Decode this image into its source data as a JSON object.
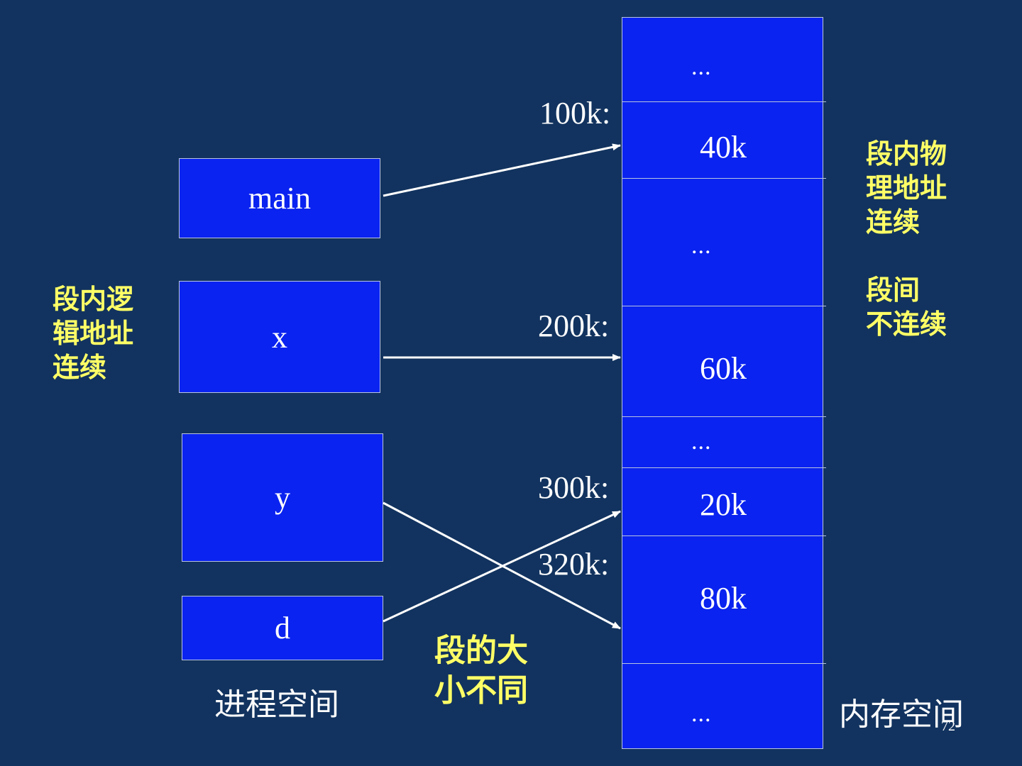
{
  "process_space": {
    "caption": "进程空间",
    "segments": [
      "main",
      "x",
      "y",
      "d"
    ]
  },
  "memory_space": {
    "caption": "内存空间",
    "blocks": [
      "...",
      "40k",
      "...",
      "60k",
      "...",
      "20k",
      "80k",
      "..."
    ],
    "addresses": [
      "100k:",
      "200k:",
      "300k:",
      "320k:"
    ]
  },
  "notes": {
    "logical": [
      "段内逻",
      "辑地址",
      "连续"
    ],
    "physical": [
      "段内物",
      "理地址",
      "连续"
    ],
    "between": [
      "段间",
      "不连续"
    ],
    "size": [
      "段的大",
      "小不同"
    ]
  },
  "slide_number": "72",
  "colors": {
    "background": "#12335f",
    "box_fill": "#0a23f0",
    "note_text": "#ffff66",
    "label_text": "#ffffff"
  }
}
